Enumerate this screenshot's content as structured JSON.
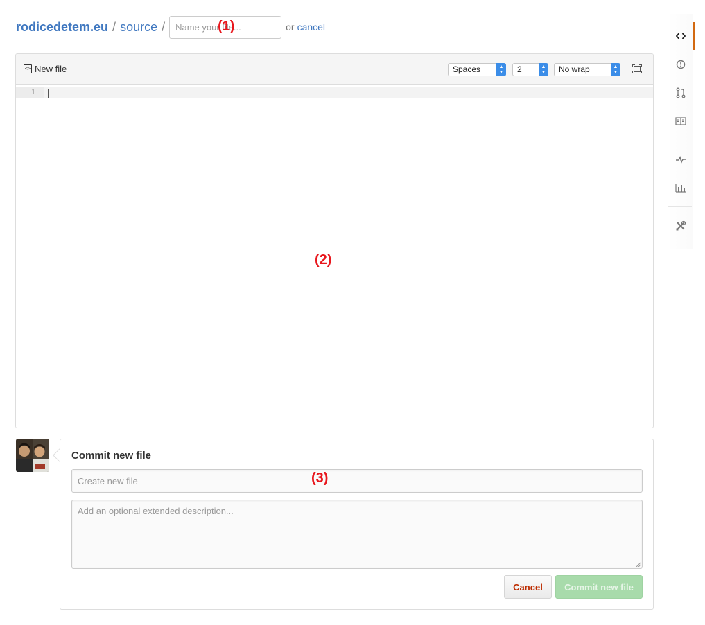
{
  "breadcrumb": {
    "repo": "rodicedetem.eu",
    "separator": "/",
    "folder": "source",
    "filename_placeholder": "Name your file...",
    "or_text": "or",
    "cancel_label": "cancel"
  },
  "editor": {
    "title": "New file",
    "indent_mode": "Spaces",
    "indent_size": "2",
    "wrap_mode": "No wrap",
    "line_numbers": [
      "1"
    ]
  },
  "commit": {
    "title": "Commit new file",
    "summary_placeholder": "Create new file",
    "description_placeholder": "Add an optional extended description...",
    "cancel_label": "Cancel",
    "commit_label": "Commit new file"
  },
  "annotations": {
    "a1": "(1)",
    "a2": "(2)",
    "a3": "(3)"
  },
  "colors": {
    "link": "#4078c0",
    "nav_active": "#d26911",
    "annotation": "#e8171d",
    "commit_button": "#a8dbab"
  },
  "side_nav": {
    "items": [
      "code-icon",
      "issue-icon",
      "pull-request-icon",
      "wiki-icon",
      "pulse-icon",
      "graph-icon",
      "settings-icon"
    ]
  }
}
